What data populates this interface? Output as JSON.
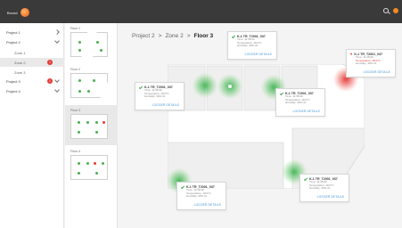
{
  "brand": {
    "logo_text": "Brand"
  },
  "tree": [
    {
      "label": "Project 1",
      "level": 0,
      "chevron": true
    },
    {
      "label": "Project 2",
      "level": 0,
      "chevron": true
    },
    {
      "label": "Zone 1",
      "level": 1
    },
    {
      "label": "Zone 2",
      "level": 1,
      "selected": true,
      "badge": "1"
    },
    {
      "label": "Zone 3",
      "level": 1
    },
    {
      "label": "Project 3",
      "level": 0,
      "chevron": true,
      "badge": "1"
    },
    {
      "label": "Project 4",
      "level": 0,
      "chevron": true
    }
  ],
  "floors": [
    {
      "label": "Floor 1"
    },
    {
      "label": "Floor 2"
    },
    {
      "label": "Floor 3",
      "active": true
    },
    {
      "label": "Floor 4"
    }
  ],
  "breadcrumb": {
    "project": "Project 2",
    "sep1": ">",
    "zone": "Zone 2",
    "sep2": ">",
    "floor": "Floor 3"
  },
  "callouts": [
    {
      "id": "K-1 TR_T2001_037",
      "time": "Time: 11:48:30",
      "temp": "Temperature: 18,0°C",
      "humidity": "Humidity: 40% rH",
      "link": "LOGGER DETAILS",
      "status": "ok"
    },
    {
      "id": "K-1 TR_T2001_037",
      "time": "Time: 11:48:30",
      "temp": "Temperature: 18,0°C",
      "humidity": "Humidity: 40% rH",
      "link": "LOGGER DETAILS",
      "status": "ok"
    },
    {
      "id": "K-1 TR_T2001_037",
      "time": "Time: 11:48:30",
      "temp": "Temperature: 18,0°C",
      "humidity": "Humidity: 40% rH",
      "link": "LOGGER DETAILS",
      "status": "ok"
    },
    {
      "id": "K-1 TR_T2001_037",
      "time": "Time: 11:48:30",
      "temp": "Temperature: 18,0°C",
      "humidity": "Humidity: 40% rH",
      "link": "LOGGER DETAILS",
      "status": "alarm"
    },
    {
      "id": "K-1 TR_T2001_037",
      "time": "Time: 11:48:30",
      "temp": "Temperature: 18,0°C",
      "humidity": "Humidity: 40% rH",
      "link": "LOGGER DETAILS",
      "status": "ok"
    },
    {
      "id": "K-1 TR_T2001_037",
      "time": "Time: 11:48:30",
      "temp": "Temperature: 18,0°C",
      "humidity": "Humidity: 40% rH",
      "link": "LOGGER DETAILS",
      "status": "ok"
    }
  ],
  "colors": {
    "ok": "#38b44a",
    "alarm": "#e53935",
    "link": "#3a8fd6",
    "topbar": "#3a3a3a"
  }
}
